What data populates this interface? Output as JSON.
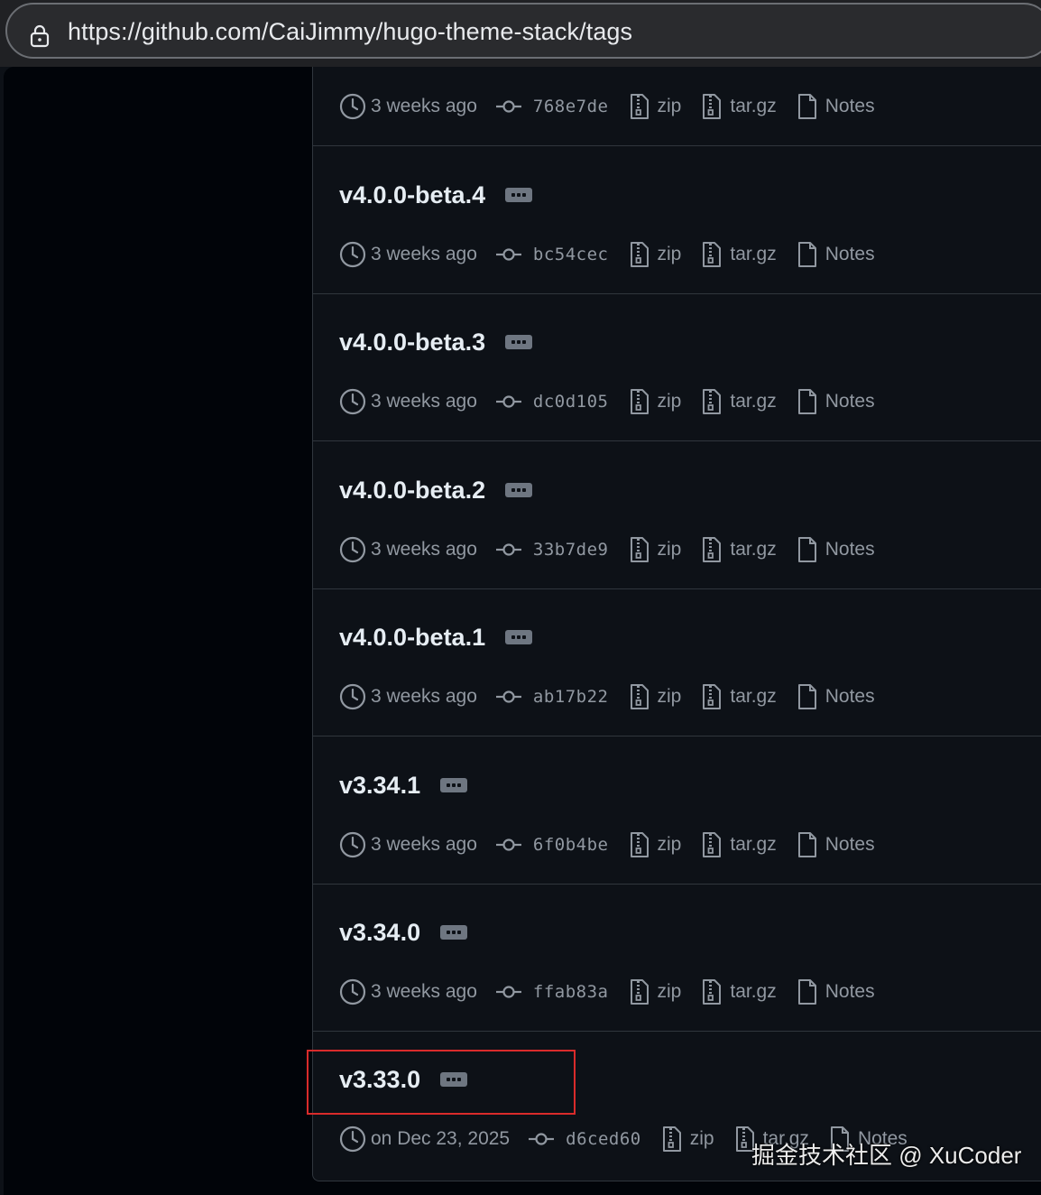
{
  "browser": {
    "url": "https://github.com/CaiJimmy/hugo-theme-stack/tags"
  },
  "tags": [
    {
      "name": "",
      "time": "3 weeks ago",
      "commit": "768e7de",
      "zip": "zip",
      "targz": "tar.gz",
      "notes": "Notes"
    },
    {
      "name": "v4.0.0-beta.4",
      "time": "3 weeks ago",
      "commit": "bc54cec",
      "zip": "zip",
      "targz": "tar.gz",
      "notes": "Notes"
    },
    {
      "name": "v4.0.0-beta.3",
      "time": "3 weeks ago",
      "commit": "dc0d105",
      "zip": "zip",
      "targz": "tar.gz",
      "notes": "Notes"
    },
    {
      "name": "v4.0.0-beta.2",
      "time": "3 weeks ago",
      "commit": "33b7de9",
      "zip": "zip",
      "targz": "tar.gz",
      "notes": "Notes"
    },
    {
      "name": "v4.0.0-beta.1",
      "time": "3 weeks ago",
      "commit": "ab17b22",
      "zip": "zip",
      "targz": "tar.gz",
      "notes": "Notes"
    },
    {
      "name": "v3.34.1",
      "time": "3 weeks ago",
      "commit": "6f0b4be",
      "zip": "zip",
      "targz": "tar.gz",
      "notes": "Notes"
    },
    {
      "name": "v3.34.0",
      "time": "3 weeks ago",
      "commit": "ffab83a",
      "zip": "zip",
      "targz": "tar.gz",
      "notes": "Notes"
    },
    {
      "name": "v3.33.0",
      "time": "on Dec 23, 2025",
      "commit": "d6ced60",
      "zip": "zip",
      "targz": "tar.gz",
      "notes": "Notes"
    }
  ],
  "watermark": "掘金技术社区 @ XuCoder",
  "colors": {
    "background": "#0d1117",
    "border": "#30363d",
    "muted_text": "#9198a1",
    "highlight": "#d92b2b"
  },
  "icons": {
    "address_bar": "lock-icon",
    "time": "clock-icon",
    "commit": "git-commit-icon",
    "archive": "file-zip-icon",
    "notes": "file-icon",
    "tag_menu": "kebab-horizontal-icon"
  }
}
